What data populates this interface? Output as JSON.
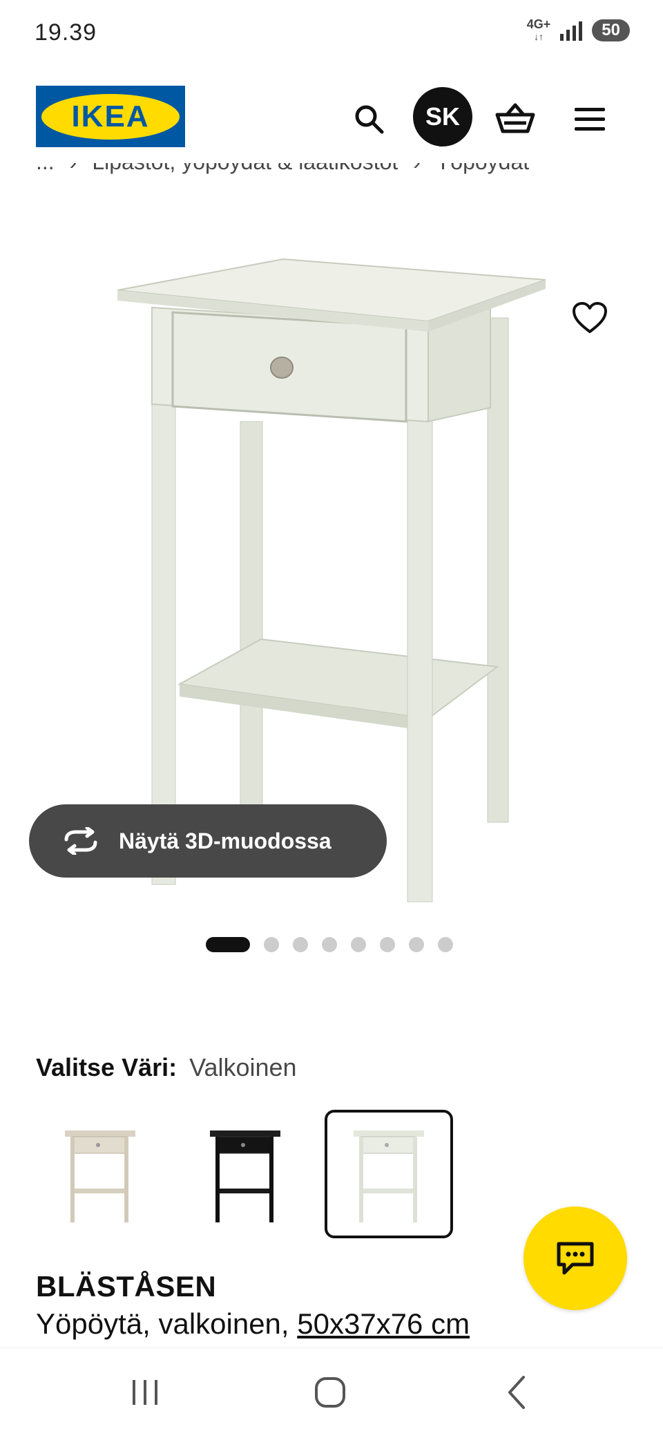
{
  "status_bar": {
    "time": "19.39",
    "network": "4G+",
    "battery": "50"
  },
  "header": {
    "brand": "IKEA",
    "avatar_initials": "SK"
  },
  "breadcrumb": {
    "ellipsis": "...",
    "items": [
      "Lipastot, yöpöydät & laatikostot",
      "Yöpöydät"
    ]
  },
  "gallery": {
    "view_3d_label": "Näytä 3D-muodossa",
    "dot_count": 8,
    "active_index": 0
  },
  "color_select": {
    "label": "Valitse Väri:",
    "selected_value": "Valkoinen",
    "options": [
      {
        "color": "#ddd6c8",
        "selected": false
      },
      {
        "color": "#1a1a1a",
        "selected": false
      },
      {
        "color": "#e4e8dc",
        "selected": true
      }
    ]
  },
  "product": {
    "name": "BLÄSTÅSEN",
    "description": "Yöpöytä, valkoinen,",
    "dimensions": "50x37x76 cm"
  },
  "colors": {
    "ikea_blue": "#0058a3",
    "ikea_yellow": "#ffdb00",
    "table_body": "#e8ebe1"
  }
}
